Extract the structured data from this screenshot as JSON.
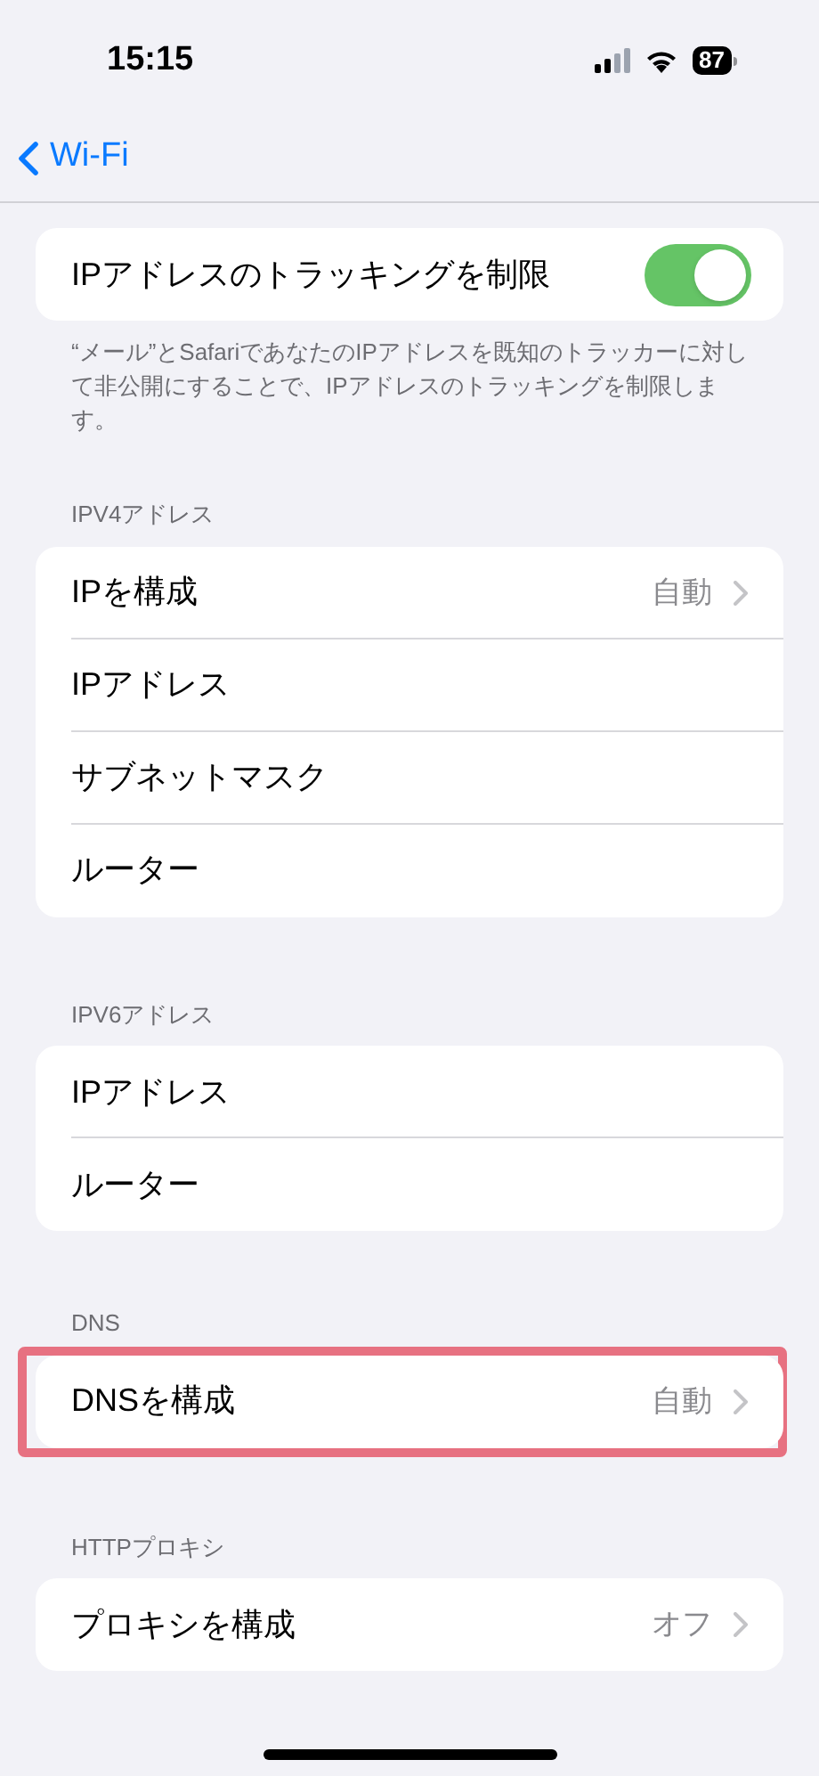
{
  "status_bar": {
    "time": "15:15",
    "battery": "87"
  },
  "nav": {
    "back_label": "Wi-Fi"
  },
  "sections": [
    {
      "footer": "“メール”とSafariであなたのIPアドレスを既知のトラッカーに対して非公開にすることで、IPアドレスのトラッキングを制限します。",
      "highlighted": false,
      "rows": [
        {
          "kind": "toggle",
          "label": "IPアドレスのトラッキングを制限",
          "on": true
        }
      ]
    },
    {
      "header": "IPV4アドレス",
      "highlighted": false,
      "rows": [
        {
          "kind": "value",
          "label": "IPを構成",
          "value": "自動"
        },
        {
          "kind": "plain",
          "label": "IPアドレス"
        },
        {
          "kind": "plain",
          "label": "サブネットマスク"
        },
        {
          "kind": "plain",
          "label": "ルーター"
        }
      ]
    },
    {
      "header": "IPV6アドレス",
      "highlighted": false,
      "rows": [
        {
          "kind": "plain",
          "label": "IPアドレス"
        },
        {
          "kind": "plain",
          "label": "ルーター"
        }
      ]
    },
    {
      "header": "DNS",
      "highlighted": true,
      "rows": [
        {
          "kind": "value",
          "label": "DNSを構成",
          "value": "自動"
        }
      ]
    },
    {
      "header": "HTTPプロキシ",
      "highlighted": false,
      "rows": [
        {
          "kind": "value",
          "label": "プロキシを構成",
          "value": "オフ"
        }
      ]
    }
  ]
}
